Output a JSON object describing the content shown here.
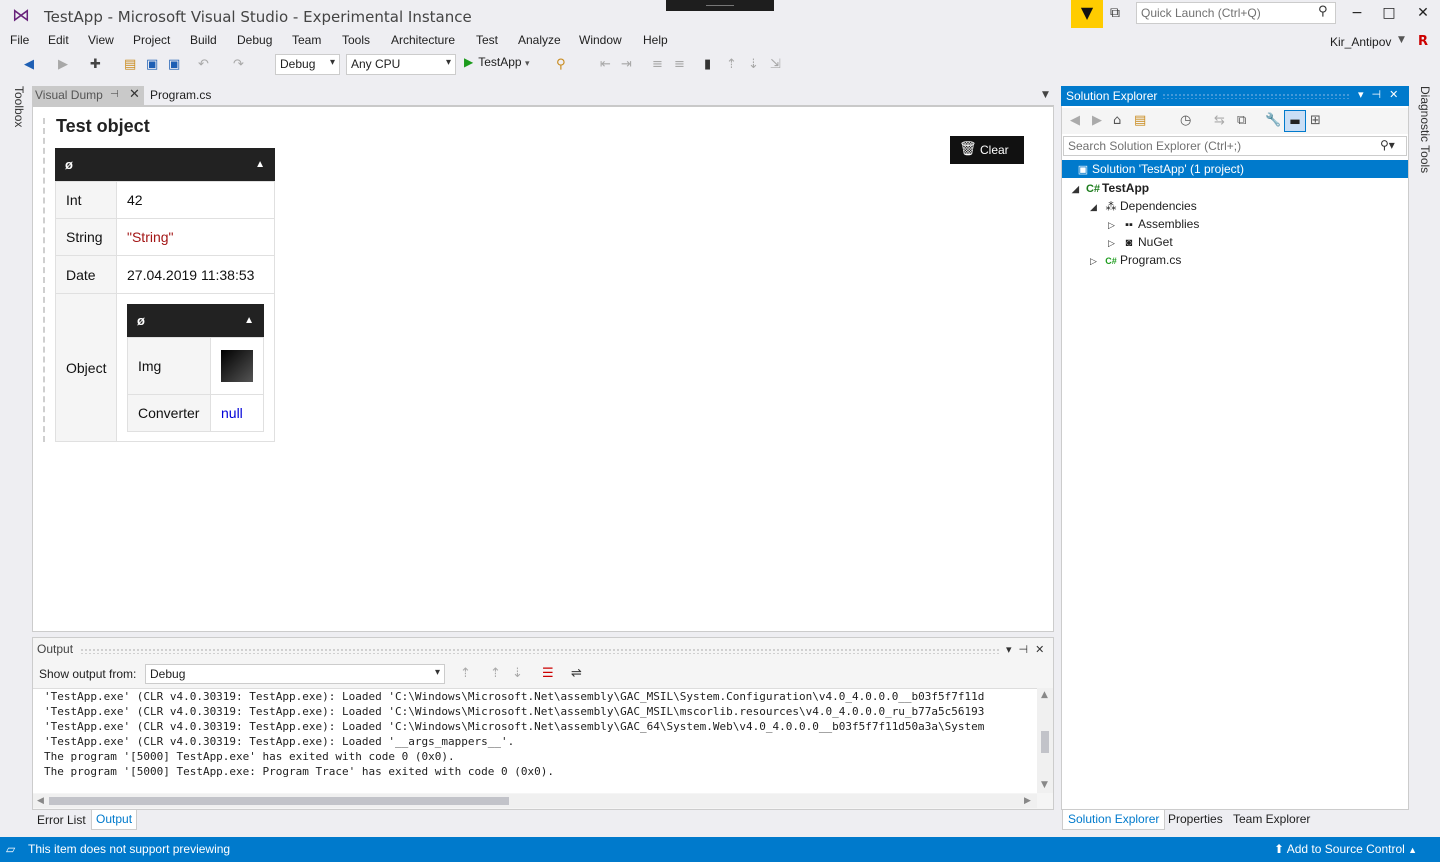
{
  "window": {
    "title": "TestApp - Microsoft Visual Studio  - Experimental Instance",
    "quick_launch_placeholder": "Quick Launch (Ctrl+Q)",
    "user": "Kir_Antipov",
    "user_avatar": "R",
    "controls": {
      "minimize": "−",
      "maximize": "□",
      "close": "✕"
    }
  },
  "menu": [
    "File",
    "Edit",
    "View",
    "Project",
    "Build",
    "Debug",
    "Team",
    "Tools",
    "Architecture",
    "Test",
    "Analyze",
    "Window",
    "Help"
  ],
  "toolbar": {
    "config": "Debug",
    "platform": "Any CPU",
    "run_target": "TestApp"
  },
  "side_strips": {
    "left": "Toolbox",
    "right": "Diagnostic Tools"
  },
  "doc_tabs": [
    {
      "label": "Visual Dump",
      "active": false
    },
    {
      "label": "Program.cs",
      "active": true
    }
  ],
  "dump": {
    "title": "Test object",
    "clear_label": "Clear",
    "header": "ø",
    "collapse_arrow": "▲",
    "rows": [
      {
        "key": "Int",
        "value": "42"
      },
      {
        "key": "String",
        "value": "\"String\""
      },
      {
        "key": "Date",
        "value": "27.04.2019 11:38:53"
      },
      {
        "key": "Object"
      }
    ],
    "nested": {
      "header": "ø",
      "rows": [
        {
          "key": "Img"
        },
        {
          "key": "Converter",
          "value": "null"
        }
      ]
    }
  },
  "solution_explorer": {
    "title": "Solution Explorer",
    "search_placeholder": "Search Solution Explorer (Ctrl+;)",
    "tree": [
      {
        "label": "Solution 'TestApp' (1 project)"
      },
      {
        "label": "TestApp"
      },
      {
        "label": "Dependencies"
      },
      {
        "label": "Assemblies"
      },
      {
        "label": "NuGet"
      },
      {
        "label": "Program.cs"
      }
    ],
    "bottom_tabs": [
      "Solution Explorer",
      "Properties",
      "Team Explorer"
    ]
  },
  "output": {
    "title": "Output",
    "show_from_label": "Show output from:",
    "show_from_value": "Debug",
    "lines": [
      "'TestApp.exe' (CLR v4.0.30319: TestApp.exe): Loaded 'C:\\Windows\\Microsoft.Net\\assembly\\GAC_MSIL\\System.Configuration\\v4.0_4.0.0.0__b03f5f7f11d",
      "'TestApp.exe' (CLR v4.0.30319: TestApp.exe): Loaded 'C:\\Windows\\Microsoft.Net\\assembly\\GAC_MSIL\\mscorlib.resources\\v4.0_4.0.0.0_ru_b77a5c56193",
      "'TestApp.exe' (CLR v4.0.30319: TestApp.exe): Loaded 'C:\\Windows\\Microsoft.Net\\assembly\\GAC_64\\System.Web\\v4.0_4.0.0.0__b03f5f7f11d50a3a\\System",
      "'TestApp.exe' (CLR v4.0.30319: TestApp.exe): Loaded '__args_mappers__'.",
      "The program '[5000] TestApp.exe' has exited with code 0 (0x0).",
      "The program '[5000] TestApp.exe: Program Trace' has exited with code 0 (0x0)."
    ],
    "tabs": [
      "Error List",
      "Output"
    ]
  },
  "status": {
    "message": "This item does not support previewing",
    "source_control": "Add to Source Control"
  },
  "colors": {
    "accent": "#007acc",
    "dark_header": "#222222",
    "string_literal": "#a31515",
    "null_keyword": "#0000d8"
  }
}
